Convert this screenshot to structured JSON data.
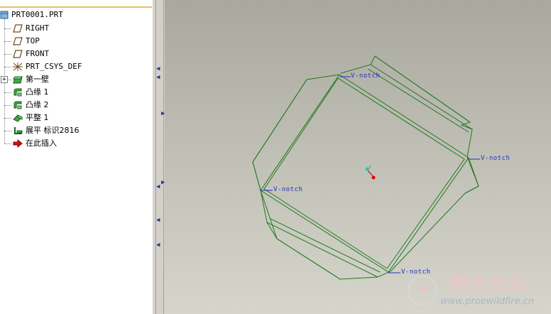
{
  "tree": {
    "root": "PRT0001.PRT",
    "items": [
      {
        "label": "RIGHT",
        "icon": "datum-plane-icon"
      },
      {
        "label": "TOP",
        "icon": "datum-plane-icon"
      },
      {
        "label": "FRONT",
        "icon": "datum-plane-icon"
      },
      {
        "label": "PRT_CSYS_DEF",
        "icon": "coordinate-system-icon"
      },
      {
        "label": "第一壁",
        "icon": "sheetmetal-wall-icon"
      },
      {
        "label": "凸缘 1",
        "icon": "flange-icon"
      },
      {
        "label": "凸缘 2",
        "icon": "flange-icon"
      },
      {
        "label": "平整 1",
        "icon": "flat-wall-icon"
      },
      {
        "label": "展平 标识2816",
        "icon": "unbend-icon"
      },
      {
        "label": "在此插入",
        "icon": "insert-here-arrow-icon"
      }
    ]
  },
  "viewport": {
    "notch_labels": [
      "V-notch",
      "V-notch",
      "V-notch",
      "V-notch"
    ],
    "edge_color": "#1f7a1f",
    "label_color": "#2030c0"
  },
  "watermark": {
    "text": "野火论坛",
    "url": "www.proewildfire.cn"
  }
}
